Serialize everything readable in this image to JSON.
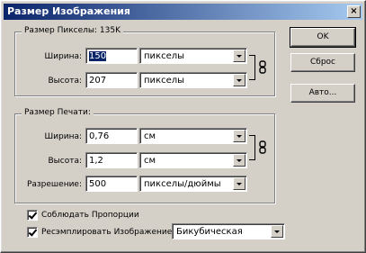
{
  "window": {
    "title": "Размер Изображения",
    "close": "×"
  },
  "pixel_dims": {
    "legend": "Размер Пикселы: 135K",
    "width_label": "Ширина:",
    "width_value": "150",
    "width_unit": "пикселы",
    "height_label": "Высота:",
    "height_value": "207",
    "height_unit": "пикселы"
  },
  "print_size": {
    "legend": "Размер Печати:",
    "width_label": "Ширина:",
    "width_value": "0,76",
    "width_unit": "см",
    "height_label": "Высота:",
    "height_value": "1,2",
    "height_unit": "см",
    "resolution_label": "Разрешение:",
    "resolution_value": "500",
    "resolution_unit": "пикселы/дюймы"
  },
  "options": {
    "constrain_label": "Соблюдать Пропорции",
    "constrain_checked": true,
    "resample_label": "Ресэмплировать Изображение",
    "resample_checked": true,
    "resample_method": "Бикубическая"
  },
  "buttons": {
    "ok": "OK",
    "reset": "Сброс",
    "auto": "Авто..."
  },
  "icons": {
    "link": "chain-link-icon",
    "dropdown": "down-arrow-icon",
    "check": "checkmark-icon"
  }
}
